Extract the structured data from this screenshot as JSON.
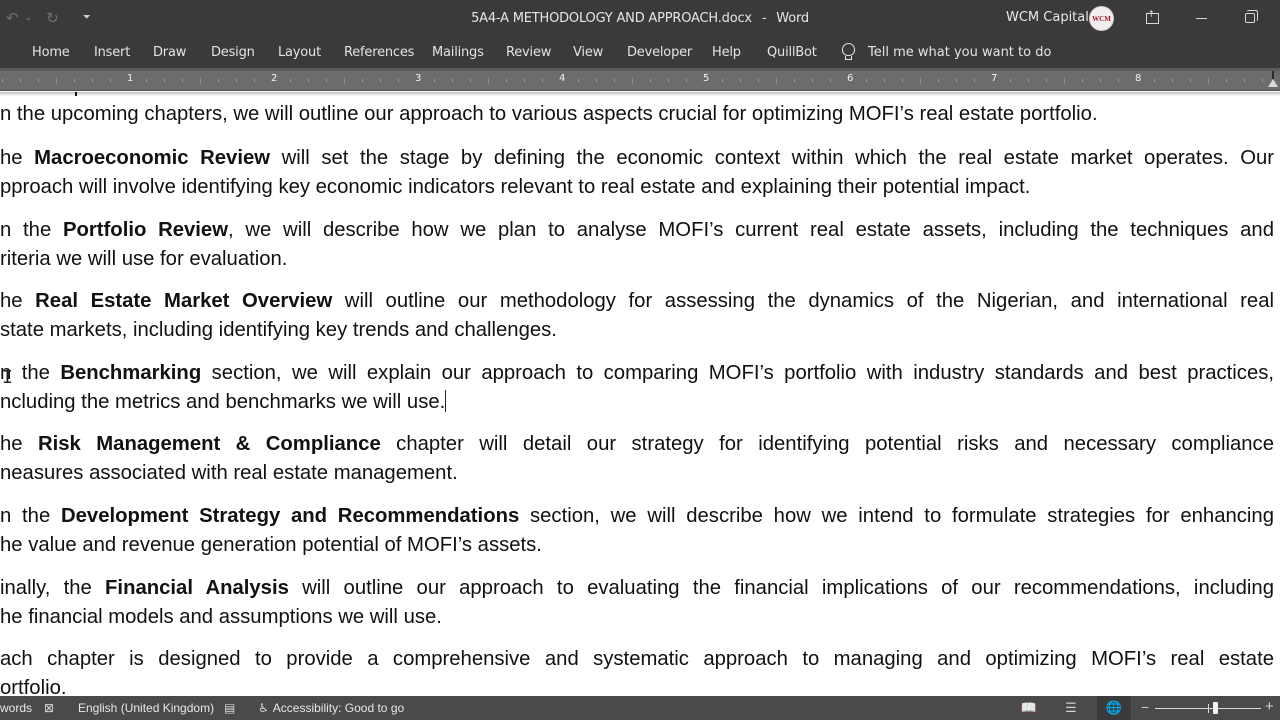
{
  "titlebar": {
    "document_title": "5A4-A METHODOLOGY AND APPROACH.docx",
    "separator": "-",
    "app_name": "Word",
    "account_name": "WCM Capital",
    "avatar_text": "WCM",
    "icons": {
      "undo": "undo-icon",
      "undo_dropdown": "chevron-down-icon",
      "redo": "redo-icon",
      "customize": "customize-quick-access-icon",
      "ribbon_display": "ribbon-display-options-icon",
      "minimize": "minimize-icon",
      "restore": "restore-icon"
    }
  },
  "ribbon": {
    "tabs": [
      {
        "label": "Home"
      },
      {
        "label": "Insert"
      },
      {
        "label": "Draw"
      },
      {
        "label": "Design"
      },
      {
        "label": "Layout"
      },
      {
        "label": "References"
      },
      {
        "label": "Mailings"
      },
      {
        "label": "Review"
      },
      {
        "label": "View"
      },
      {
        "label": "Developer"
      },
      {
        "label": "Help"
      },
      {
        "label": "QuillBot"
      }
    ],
    "tell_me_placeholder": "Tell me what you want to do"
  },
  "ruler": {
    "numbers": [
      "1",
      "2",
      "3",
      "4",
      "5",
      "6",
      "7",
      "8"
    ]
  },
  "document": {
    "paragraphs": [
      {
        "lines": [
          [
            {
              "t": "n the upcoming chapters, we will outline our approach to various aspects crucial for optimizing MOFI’s real estate portfolio."
            }
          ]
        ]
      },
      {
        "lines": [
          [
            {
              "t": "he "
            },
            {
              "t": "Macroeconomic Review",
              "b": true
            },
            {
              "t": " will set the stage by defining the economic context within which the real estate market operates. Our"
            }
          ],
          [
            {
              "t": "pproach will involve identifying key economic indicators relevant to real estate and explaining their potential impact."
            }
          ]
        ]
      },
      {
        "lines": [
          [
            {
              "t": "n the "
            },
            {
              "t": "Portfolio Review",
              "b": true
            },
            {
              "t": ", we will describe how we plan to analyse MOFI’s current real estate assets, including the techniques and"
            }
          ],
          [
            {
              "t": "riteria we will use for evaluation."
            }
          ]
        ]
      },
      {
        "lines": [
          [
            {
              "t": "he "
            },
            {
              "t": "Real Estate Market Overview",
              "b": true
            },
            {
              "t": " will outline our methodology for assessing the dynamics of the Nigerian, and international real"
            }
          ],
          [
            {
              "t": "state markets, including identifying key trends and challenges."
            }
          ]
        ]
      },
      {
        "lines": [
          [
            {
              "t": "n the "
            },
            {
              "t": "Benchmarking",
              "b": true
            },
            {
              "t": " section, we will explain our approach to comparing MOFI’s portfolio with industry standards and best practices,"
            }
          ],
          [
            {
              "t": "ncluding the metrics and benchmarks we will use."
            }
          ]
        ],
        "has_cursor": true
      },
      {
        "lines": [
          [
            {
              "t": "he "
            },
            {
              "t": "Risk Management & Compliance",
              "b": true
            },
            {
              "t": " chapter will detail our strategy for identifying potential risks and necessary compliance"
            }
          ],
          [
            {
              "t": "neasures associated with real estate management."
            }
          ]
        ]
      },
      {
        "lines": [
          [
            {
              "t": "n the "
            },
            {
              "t": "Development Strategy and Recommendations",
              "b": true
            },
            {
              "t": " section, we will describe how we intend to formulate strategies for enhancing"
            }
          ],
          [
            {
              "t": "he value and revenue generation potential of MOFI’s assets."
            }
          ]
        ]
      },
      {
        "lines": [
          [
            {
              "t": "inally, the "
            },
            {
              "t": "Financial Analysis",
              "b": true
            },
            {
              "t": " will outline our approach to evaluating the financial implications of our recommendations, including"
            }
          ],
          [
            {
              "t": "he financial models and assumptions we will use."
            }
          ]
        ]
      },
      {
        "lines": [
          [
            {
              "t": "ach chapter is designed to provide a comprehensive and systematic approach to managing and optimizing MOFI’s real estate"
            }
          ],
          [
            {
              "t": "ortfolio."
            }
          ]
        ]
      }
    ]
  },
  "statusbar": {
    "word_count": "words",
    "language": "English (United Kingdom)",
    "accessibility": "Accessibility: Good to go",
    "zoom_minus": "−",
    "zoom_plus": "+",
    "zoom_slider_fraction": 0.57,
    "active_view": "web-layout"
  }
}
